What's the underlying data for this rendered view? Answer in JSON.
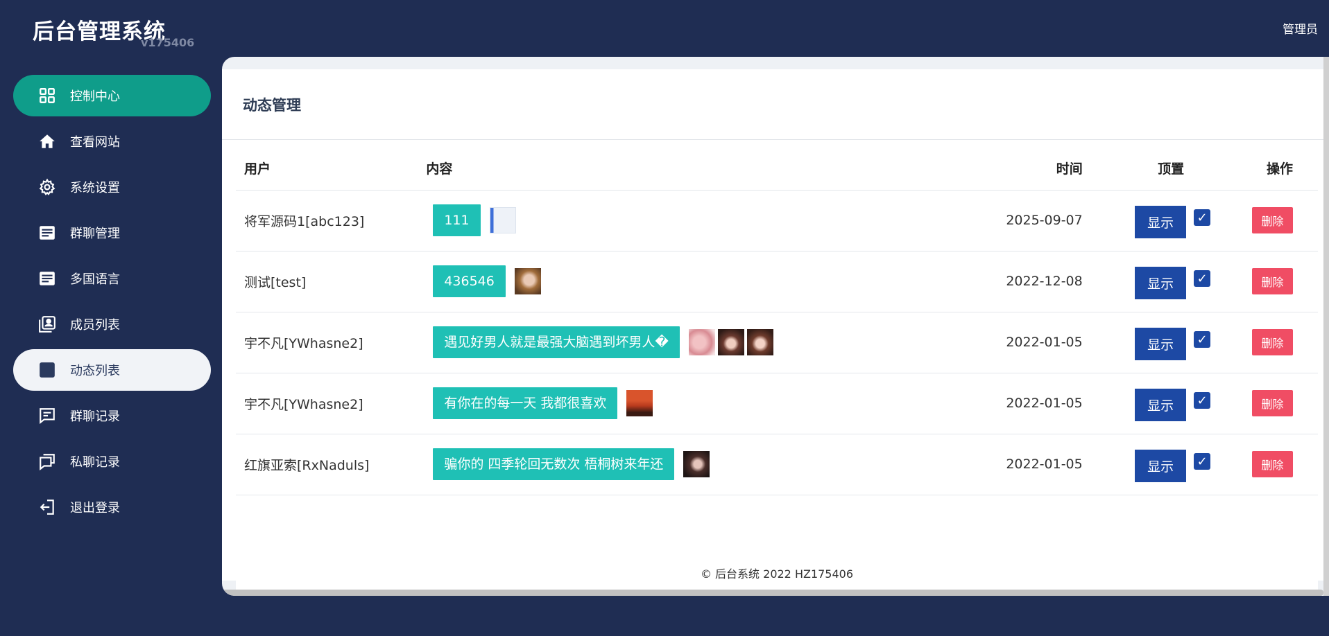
{
  "header": {
    "title": "后台管理系统",
    "version": "v175406",
    "user": "管理员"
  },
  "sidebar": {
    "items": [
      {
        "label": "控制中心",
        "icon": "dashboard-icon"
      },
      {
        "label": "查看网站",
        "icon": "home-icon"
      },
      {
        "label": "系统设置",
        "icon": "gear-icon"
      },
      {
        "label": "群聊管理",
        "icon": "document-icon"
      },
      {
        "label": "多国语言",
        "icon": "document-icon"
      },
      {
        "label": "成员列表",
        "icon": "contacts-icon"
      },
      {
        "label": "动态列表",
        "icon": "list-icon"
      },
      {
        "label": "群聊记录",
        "icon": "chat-icon"
      },
      {
        "label": "私聊记录",
        "icon": "chats-icon"
      },
      {
        "label": "退出登录",
        "icon": "logout-icon"
      }
    ]
  },
  "main": {
    "title": "动态管理",
    "columns": {
      "user": "用户",
      "content": "内容",
      "time": "时间",
      "top": "顶置",
      "op": "操作"
    },
    "rows": [
      {
        "user": "将军源码1[abc123]",
        "content": "111",
        "time": "2025-09-07",
        "show": "显示",
        "pinned": true,
        "delete": "删除"
      },
      {
        "user": "测试[test]",
        "content": "436546",
        "time": "2022-12-08",
        "show": "显示",
        "pinned": true,
        "delete": "删除"
      },
      {
        "user": "宇不凡[YWhasne2]",
        "content": "遇见好男人就是最强大脑遇到坏男人�",
        "time": "2022-01-05",
        "show": "显示",
        "pinned": true,
        "delete": "删除"
      },
      {
        "user": "宇不凡[YWhasne2]",
        "content": "有你在的每一天 我都很喜欢",
        "time": "2022-01-05",
        "show": "显示",
        "pinned": true,
        "delete": "删除"
      },
      {
        "user": "红旗亚索[RxNaduls]",
        "content": "骗你的 四季轮回无数次 梧桐树来年还",
        "time": "2022-01-05",
        "show": "显示",
        "pinned": true,
        "delete": "删除"
      }
    ],
    "footer": "© 后台系统 2022 HZ175406"
  },
  "colors": {
    "bg": "#1f2d53",
    "active_green": "#0f9d8a",
    "tag": "#1fc0b5",
    "show_btn": "#1d49a4",
    "delete_btn": "#f04d64"
  }
}
